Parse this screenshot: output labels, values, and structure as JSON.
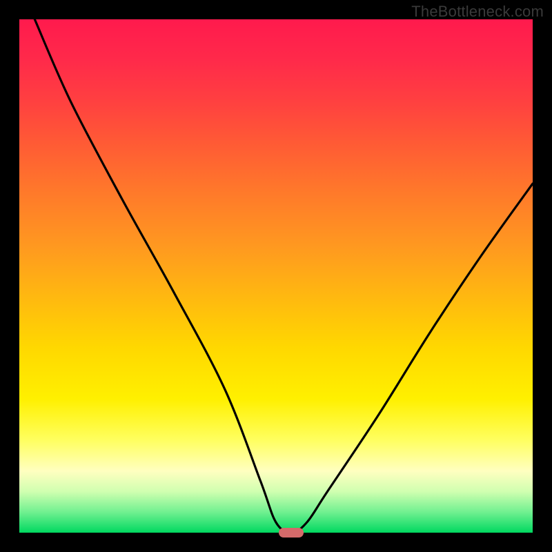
{
  "watermark": "TheBottleneck.com",
  "chart_data": {
    "type": "line",
    "title": "",
    "xlabel": "",
    "ylabel": "",
    "xlim": [
      0,
      100
    ],
    "ylim": [
      0,
      100
    ],
    "grid": false,
    "series": [
      {
        "name": "bottleneck-curve",
        "x": [
          3,
          10,
          20,
          30,
          40,
          47,
          50,
          53,
          56,
          60,
          70,
          80,
          90,
          100
        ],
        "y": [
          100,
          84,
          65,
          47,
          28,
          10,
          2,
          0,
          2,
          8,
          23,
          39,
          54,
          68
        ]
      }
    ],
    "marker": {
      "x": 53,
      "y": 0,
      "shape": "pill",
      "color": "#d46a6a"
    },
    "gradient_stops": [
      {
        "pos": 0,
        "color": "#ff1a4d"
      },
      {
        "pos": 50,
        "color": "#ffb000"
      },
      {
        "pos": 75,
        "color": "#ffff00"
      },
      {
        "pos": 100,
        "color": "#00d860"
      }
    ]
  }
}
